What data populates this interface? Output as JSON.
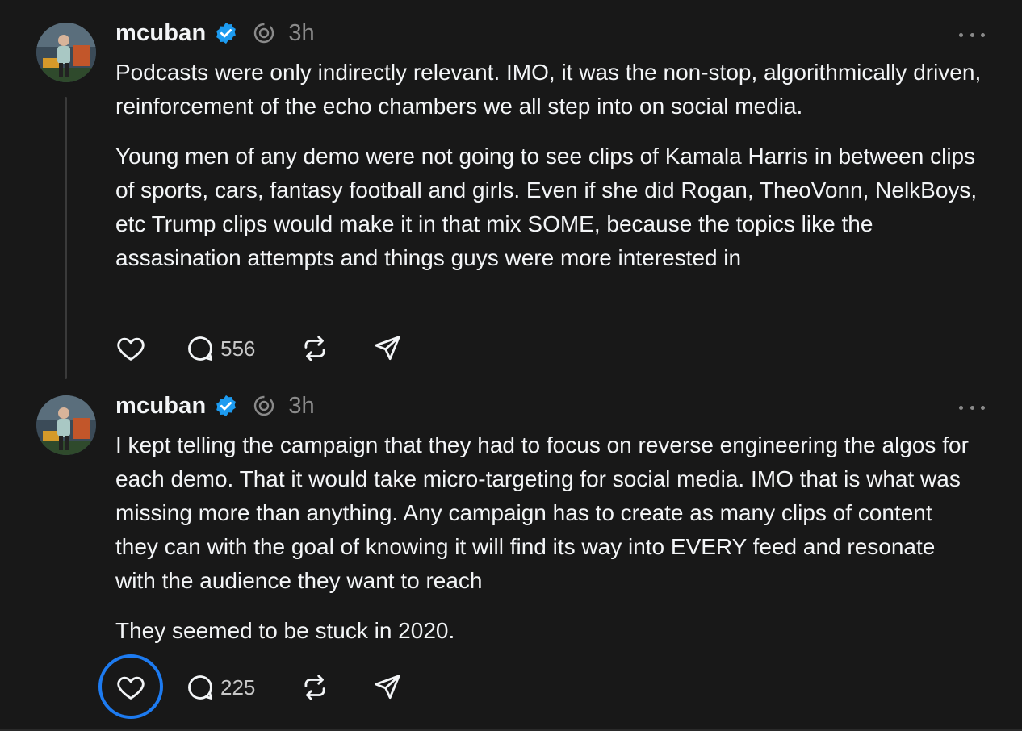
{
  "posts": [
    {
      "username": "mcuban",
      "time": "3h",
      "paragraphs": [
        "Podcasts were only indirectly relevant. IMO, it was the non-stop, algorithmically driven, reinforcement of the echo chambers we all step into on social media.",
        "Young men of any demo were not going to see clips of Kamala Harris in between clips of sports, cars, fantasy football and girls. Even if she did Rogan, TheoVonn, NelkBoys, etc Trump clips would make it in that mix SOME, because the topics like the assasination attempts and things guys were more interested in"
      ],
      "reply_count": "556"
    },
    {
      "username": "mcuban",
      "time": "3h",
      "paragraphs": [
        "I kept telling the campaign that they had to focus on reverse engineering the algos for each demo. That it would take micro-targeting for social media. IMO that is what was missing more than anything. Any campaign has to create as many clips of content they can with the goal of knowing it will find its way into EVERY feed and resonate with the audience they want to reach",
        "They seemed to be stuck in 2020."
      ],
      "reply_count": "225"
    }
  ],
  "icons": {
    "verified": "verified-badge-icon",
    "threads": "threads-logo-icon",
    "more": "more-options-icon",
    "like": "heart-icon",
    "reply": "comment-icon",
    "repost": "repost-icon",
    "share": "send-icon"
  },
  "colors": {
    "background": "#181818",
    "text": "#f3f5f7",
    "muted": "#8a8a8a",
    "verified": "#1d9bf0",
    "focus_ring": "#1d7bf1"
  }
}
